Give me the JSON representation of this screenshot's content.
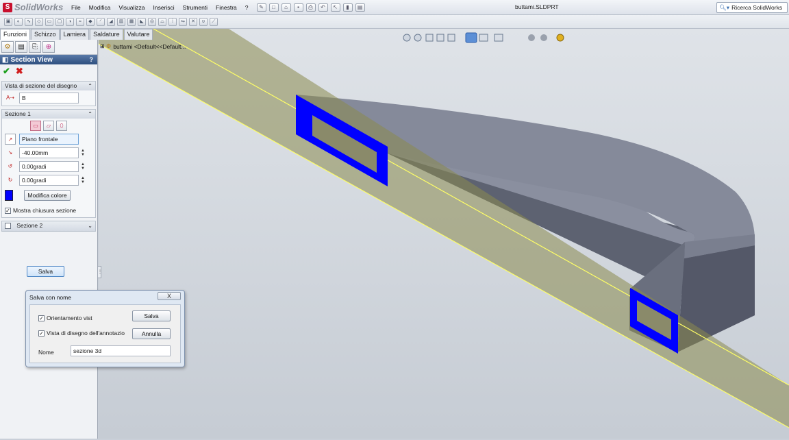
{
  "app": {
    "logo_text": "SolidWorks",
    "menu": [
      "File",
      "Modifica",
      "Visualizza",
      "Inserisci",
      "Strumenti",
      "Finestra",
      "?"
    ],
    "document_title": "buttami.SLDPRT",
    "search_placeholder": "Ricerca SolidWorks"
  },
  "command_tabs": [
    "Funzioni",
    "Schizzo",
    "Lamiera",
    "Saldature",
    "Valutare"
  ],
  "feature_tree": {
    "root_label": "buttami  <Default<<Default..."
  },
  "property_manager": {
    "title": "Section View",
    "help": "?",
    "drawing_section_group": {
      "header": "Vista di sezione del disegno",
      "label_value": "B"
    },
    "section1": {
      "header": "Sezione 1",
      "reference_plane": "Piano frontale",
      "offset": "-40.00mm",
      "rotation_x": "0.00gradi",
      "rotation_y": "0.00gradi",
      "color_button": "Modifica colore",
      "color_swatch": "#0000ff",
      "show_cap_label": "Mostra chiusura sezione",
      "show_cap_checked": true
    },
    "section2": {
      "header": "Sezione 2",
      "checked": false
    },
    "save_button": "Salva"
  },
  "save_dialog": {
    "title": "Salva con nome",
    "close_glyph": "X",
    "orientation_label": "Orientamento vist",
    "orientation_checked": true,
    "annotation_label": "Vista di disegno dell'annotazio",
    "annotation_checked": true,
    "save_button": "Salva",
    "cancel_button": "Annulla",
    "name_label": "Nome",
    "name_value": "sezione 3d"
  },
  "colors": {
    "section_cap": "#0000ff",
    "plane_fill": "#8a8a4e",
    "plane_edge": "#ffff66",
    "part_top": "#878c9c",
    "part_side": "#5c6170",
    "viewport_bg": "#d0d5dd"
  }
}
